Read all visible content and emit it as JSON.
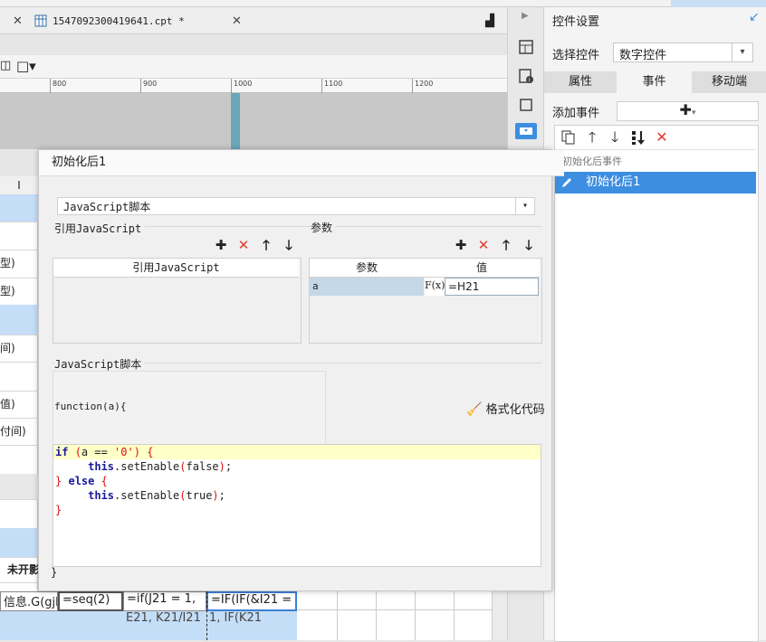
{
  "editor": {
    "tab_filename": "1547092300419641.cpt *",
    "ruler_ticks": [
      "800",
      "900",
      "1000",
      "1100",
      "1200"
    ],
    "left_rows": [
      "I",
      "",
      "",
      "型)",
      "型)",
      "",
      "间)",
      "",
      "值)",
      "付间)",
      "",
      "",
      "",
      "",
      "未开影"
    ],
    "bottom_cells": [
      "信息.G(gjbh",
      "=seq(2)",
      "=if(J21 = 1,",
      "=IF(IF(&I21 ="
    ],
    "bottom_cells_2": [
      "",
      "",
      "E21, K21/I21",
      "1, IF(K21"
    ]
  },
  "panel": {
    "title": "控件设置",
    "select_label": "选择控件",
    "select_value": "数字控件",
    "tabs": [
      "属性",
      "事件",
      "移动端"
    ],
    "active_tab": "事件",
    "add_event_label": "添加事件",
    "event_category": "初始化后事件",
    "event_item": "初始化后1"
  },
  "dialog": {
    "title": "初始化后1",
    "type_value": "JavaScript脚本",
    "ref_js_section": "引用JavaScript",
    "ref_js_column": "引用JavaScript",
    "params_section": "参数",
    "param_col": "参数",
    "value_col": "值",
    "param_name": "a",
    "fx_label": "F(x)",
    "param_value": "=H21",
    "script_section": "JavaScript脚本",
    "func_signature": "function(a){",
    "format_button": "格式化代码",
    "closing_brace": "}"
  },
  "colors": {
    "selection_blue": "#3d8ee0",
    "highlight_line": "#ffffc8",
    "delete_red": "#e23b2e",
    "column_marker": "#6aa7b8"
  }
}
